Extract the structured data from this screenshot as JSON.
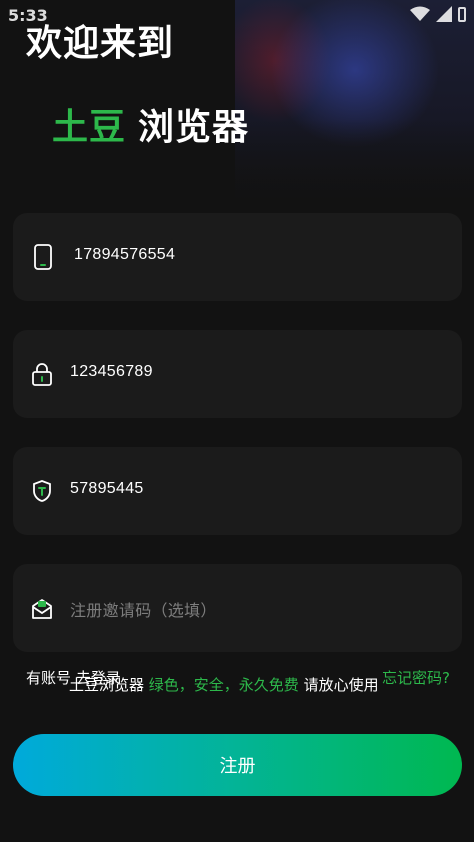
{
  "status_bar": {
    "time": "5:33"
  },
  "header": {
    "welcome": "欢迎来到",
    "brand_accent": "土豆",
    "brand_rest": "浏览器"
  },
  "form": {
    "phone": {
      "icon": "phone-icon",
      "value": "17894576554"
    },
    "password": {
      "icon": "lock-icon",
      "value": "123456789"
    },
    "code": {
      "icon": "shield-icon",
      "value": "57895445"
    },
    "invite": {
      "icon": "mail-icon",
      "placeholder": "注册邀请码（选填）"
    }
  },
  "links": {
    "login": "有账号 去登录",
    "forgot": "忘记密码?"
  },
  "tagline": {
    "prefix": "土豆浏览器",
    "highlight": "绿色，安全，永久免费",
    "suffix": "请放心使用"
  },
  "register_label": "注册",
  "colors": {
    "accent": "#2db84b",
    "background": "#121212",
    "field_bg": "#1b1b1b",
    "button_gradient_start": "#00aadb",
    "button_gradient_end": "#00b850"
  }
}
